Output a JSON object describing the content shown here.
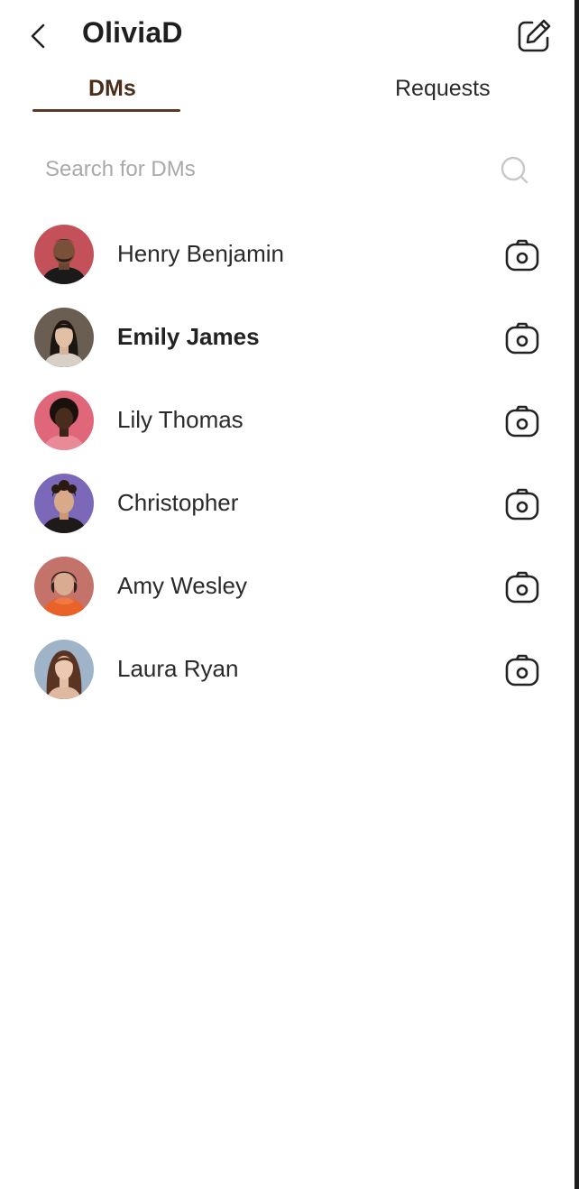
{
  "header": {
    "title": "OliviaD",
    "back_icon": "chevron-left-icon",
    "compose_icon": "edit-square-icon"
  },
  "tabs": [
    {
      "label": "DMs",
      "active": true
    },
    {
      "label": "Requests",
      "active": false
    }
  ],
  "colors": {
    "accent": "#5a3a26",
    "active_tab_text": "#4a2d1a",
    "placeholder": "#a9a9a9"
  },
  "search": {
    "placeholder": "Search for DMs",
    "value": "",
    "icon": "search-icon"
  },
  "dms": [
    {
      "name": "Henry Benjamin",
      "unread": false,
      "avatar_bg": "#c4505a",
      "camera_icon": "camera-icon"
    },
    {
      "name": "Emily James",
      "unread": true,
      "avatar_bg": "#6a5e52",
      "camera_icon": "camera-icon"
    },
    {
      "name": "Lily Thomas",
      "unread": false,
      "avatar_bg": "#e0667a",
      "camera_icon": "camera-icon"
    },
    {
      "name": "Christopher",
      "unread": false,
      "avatar_bg": "#7b68b8",
      "camera_icon": "camera-icon"
    },
    {
      "name": "Amy Wesley",
      "unread": false,
      "avatar_bg": "#c4736a",
      "camera_icon": "camera-icon"
    },
    {
      "name": "Laura Ryan",
      "unread": false,
      "avatar_bg": "#9fb4c8",
      "camera_icon": "camera-icon"
    }
  ]
}
